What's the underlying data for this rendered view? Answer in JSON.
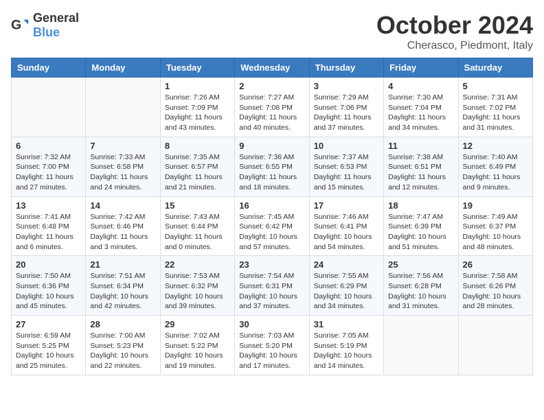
{
  "header": {
    "logo_general": "General",
    "logo_blue": "Blue",
    "month_title": "October 2024",
    "location": "Cherasco, Piedmont, Italy"
  },
  "weekdays": [
    "Sunday",
    "Monday",
    "Tuesday",
    "Wednesday",
    "Thursday",
    "Friday",
    "Saturday"
  ],
  "weeks": [
    [
      {
        "day": "",
        "info": ""
      },
      {
        "day": "",
        "info": ""
      },
      {
        "day": "1",
        "info": "Sunrise: 7:26 AM\nSunset: 7:09 PM\nDaylight: 11 hours and 43 minutes."
      },
      {
        "day": "2",
        "info": "Sunrise: 7:27 AM\nSunset: 7:08 PM\nDaylight: 11 hours and 40 minutes."
      },
      {
        "day": "3",
        "info": "Sunrise: 7:29 AM\nSunset: 7:06 PM\nDaylight: 11 hours and 37 minutes."
      },
      {
        "day": "4",
        "info": "Sunrise: 7:30 AM\nSunset: 7:04 PM\nDaylight: 11 hours and 34 minutes."
      },
      {
        "day": "5",
        "info": "Sunrise: 7:31 AM\nSunset: 7:02 PM\nDaylight: 11 hours and 31 minutes."
      }
    ],
    [
      {
        "day": "6",
        "info": "Sunrise: 7:32 AM\nSunset: 7:00 PM\nDaylight: 11 hours and 27 minutes."
      },
      {
        "day": "7",
        "info": "Sunrise: 7:33 AM\nSunset: 6:58 PM\nDaylight: 11 hours and 24 minutes."
      },
      {
        "day": "8",
        "info": "Sunrise: 7:35 AM\nSunset: 6:57 PM\nDaylight: 11 hours and 21 minutes."
      },
      {
        "day": "9",
        "info": "Sunrise: 7:36 AM\nSunset: 6:55 PM\nDaylight: 11 hours and 18 minutes."
      },
      {
        "day": "10",
        "info": "Sunrise: 7:37 AM\nSunset: 6:53 PM\nDaylight: 11 hours and 15 minutes."
      },
      {
        "day": "11",
        "info": "Sunrise: 7:38 AM\nSunset: 6:51 PM\nDaylight: 11 hours and 12 minutes."
      },
      {
        "day": "12",
        "info": "Sunrise: 7:40 AM\nSunset: 6:49 PM\nDaylight: 11 hours and 9 minutes."
      }
    ],
    [
      {
        "day": "13",
        "info": "Sunrise: 7:41 AM\nSunset: 6:48 PM\nDaylight: 11 hours and 6 minutes."
      },
      {
        "day": "14",
        "info": "Sunrise: 7:42 AM\nSunset: 6:46 PM\nDaylight: 11 hours and 3 minutes."
      },
      {
        "day": "15",
        "info": "Sunrise: 7:43 AM\nSunset: 6:44 PM\nDaylight: 11 hours and 0 minutes."
      },
      {
        "day": "16",
        "info": "Sunrise: 7:45 AM\nSunset: 6:42 PM\nDaylight: 10 hours and 57 minutes."
      },
      {
        "day": "17",
        "info": "Sunrise: 7:46 AM\nSunset: 6:41 PM\nDaylight: 10 hours and 54 minutes."
      },
      {
        "day": "18",
        "info": "Sunrise: 7:47 AM\nSunset: 6:39 PM\nDaylight: 10 hours and 51 minutes."
      },
      {
        "day": "19",
        "info": "Sunrise: 7:49 AM\nSunset: 6:37 PM\nDaylight: 10 hours and 48 minutes."
      }
    ],
    [
      {
        "day": "20",
        "info": "Sunrise: 7:50 AM\nSunset: 6:36 PM\nDaylight: 10 hours and 45 minutes."
      },
      {
        "day": "21",
        "info": "Sunrise: 7:51 AM\nSunset: 6:34 PM\nDaylight: 10 hours and 42 minutes."
      },
      {
        "day": "22",
        "info": "Sunrise: 7:53 AM\nSunset: 6:32 PM\nDaylight: 10 hours and 39 minutes."
      },
      {
        "day": "23",
        "info": "Sunrise: 7:54 AM\nSunset: 6:31 PM\nDaylight: 10 hours and 37 minutes."
      },
      {
        "day": "24",
        "info": "Sunrise: 7:55 AM\nSunset: 6:29 PM\nDaylight: 10 hours and 34 minutes."
      },
      {
        "day": "25",
        "info": "Sunrise: 7:56 AM\nSunset: 6:28 PM\nDaylight: 10 hours and 31 minutes."
      },
      {
        "day": "26",
        "info": "Sunrise: 7:58 AM\nSunset: 6:26 PM\nDaylight: 10 hours and 28 minutes."
      }
    ],
    [
      {
        "day": "27",
        "info": "Sunrise: 6:59 AM\nSunset: 5:25 PM\nDaylight: 10 hours and 25 minutes."
      },
      {
        "day": "28",
        "info": "Sunrise: 7:00 AM\nSunset: 5:23 PM\nDaylight: 10 hours and 22 minutes."
      },
      {
        "day": "29",
        "info": "Sunrise: 7:02 AM\nSunset: 5:22 PM\nDaylight: 10 hours and 19 minutes."
      },
      {
        "day": "30",
        "info": "Sunrise: 7:03 AM\nSunset: 5:20 PM\nDaylight: 10 hours and 17 minutes."
      },
      {
        "day": "31",
        "info": "Sunrise: 7:05 AM\nSunset: 5:19 PM\nDaylight: 10 hours and 14 minutes."
      },
      {
        "day": "",
        "info": ""
      },
      {
        "day": "",
        "info": ""
      }
    ]
  ]
}
